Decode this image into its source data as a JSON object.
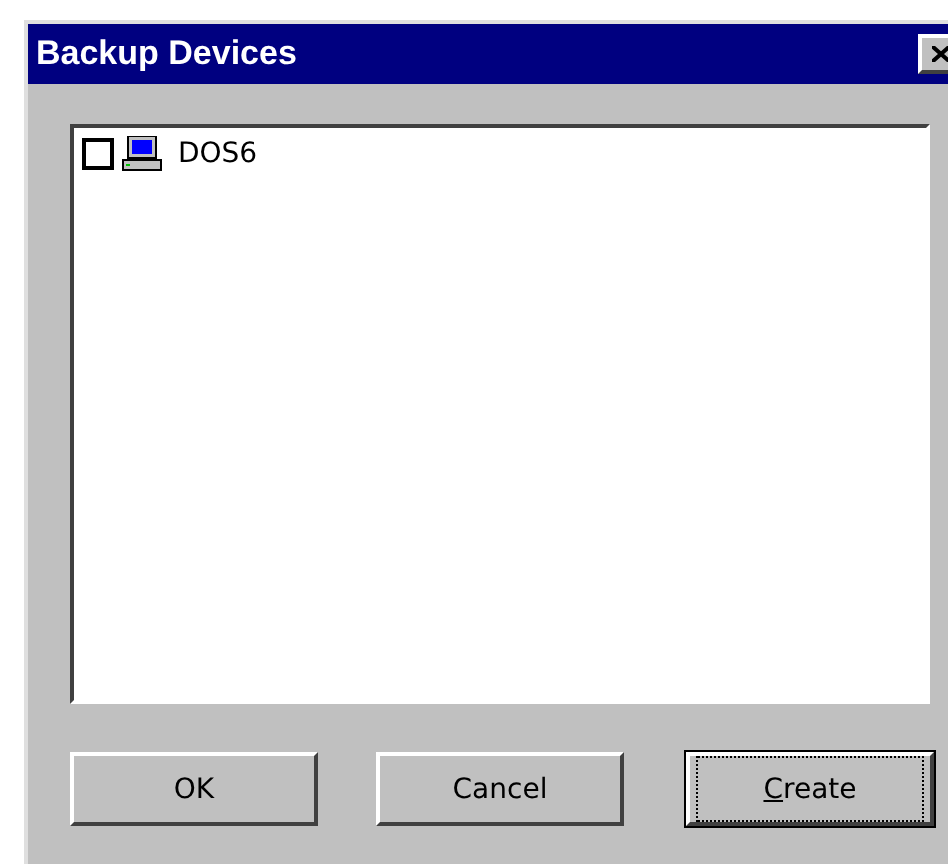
{
  "window": {
    "title": "Backup Devices"
  },
  "devices": [
    {
      "label": "DOS6",
      "checked": false
    }
  ],
  "buttons": [
    {
      "label": "OK",
      "default": false,
      "mnemonic_first": false
    },
    {
      "label": "Cancel",
      "default": false,
      "mnemonic_first": false
    },
    {
      "label": "Create",
      "default": true,
      "mnemonic_first": true
    }
  ]
}
